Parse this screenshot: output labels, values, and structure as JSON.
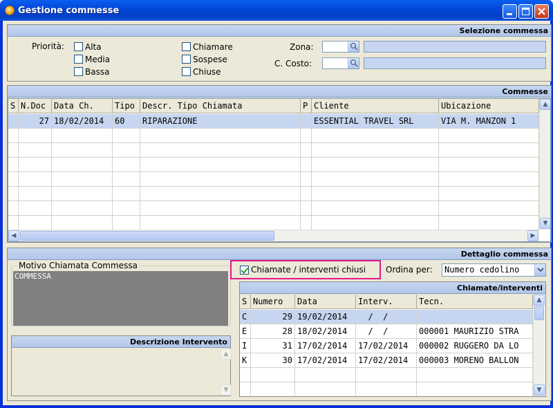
{
  "window": {
    "title": "Gestione commesse"
  },
  "selezione": {
    "header": "Selezione commessa",
    "priorita_label": "Priorità:",
    "checks_col1": [
      {
        "label": "Alta"
      },
      {
        "label": "Media"
      },
      {
        "label": "Bassa"
      }
    ],
    "checks_col2": [
      {
        "label": "Chiamare"
      },
      {
        "label": "Sospese"
      },
      {
        "label": "Chiuse"
      }
    ],
    "zona_label": "Zona:",
    "costo_label": "C. Costo:"
  },
  "commesse": {
    "header": "Commesse",
    "columns": [
      "S",
      "N.Doc",
      "Data Ch.",
      "Tipo",
      "Descr. Tipo Chiamata",
      "P",
      "Cliente",
      "Ubicazione"
    ],
    "rows": [
      {
        "s": "",
        "ndoc": "27",
        "data": "18/02/2014",
        "tipo": "60",
        "descr": "RIPARAZIONE",
        "p": "",
        "cliente": "ESSENTIAL TRAVEL SRL",
        "ubic": "VIA M. MANZON 1"
      }
    ]
  },
  "dettaglio": {
    "header": "Dettaglio commessa",
    "motivo_title": "Motivo Chiamata Commessa",
    "motivo_text": "COMMESSA",
    "descr_header": "Descrizione Intervento",
    "chiusi_label": "Chiamate / interventi chiusi",
    "chiusi_checked": true,
    "ordina_label": "Ordina per:",
    "ordina_value": "Numero cedolino",
    "interventi_header": "Chiamate/interventi",
    "int_columns": [
      "S",
      "Numero",
      "Data",
      "Interv.",
      "Tecn."
    ],
    "int_rows": [
      {
        "s": "C",
        "numero": "29",
        "data": "19/02/2014",
        "interv": "  /  /",
        "tecn": ""
      },
      {
        "s": "E",
        "numero": "28",
        "data": "18/02/2014",
        "interv": "  /  /",
        "tecn": "000001 MAURIZIO STRA"
      },
      {
        "s": "I",
        "numero": "31",
        "data": "17/02/2014",
        "interv": "17/02/2014",
        "tecn": "000002 RUGGERO DA LO"
      },
      {
        "s": "K",
        "numero": "30",
        "data": "17/02/2014",
        "interv": "17/02/2014",
        "tecn": "000003 MORENO BALLON"
      }
    ]
  },
  "colors": {
    "titlebar": "#0446d6",
    "header_band": "#c6d6f0",
    "selection": "#c6d6f0",
    "highlight": "#e0188c"
  }
}
